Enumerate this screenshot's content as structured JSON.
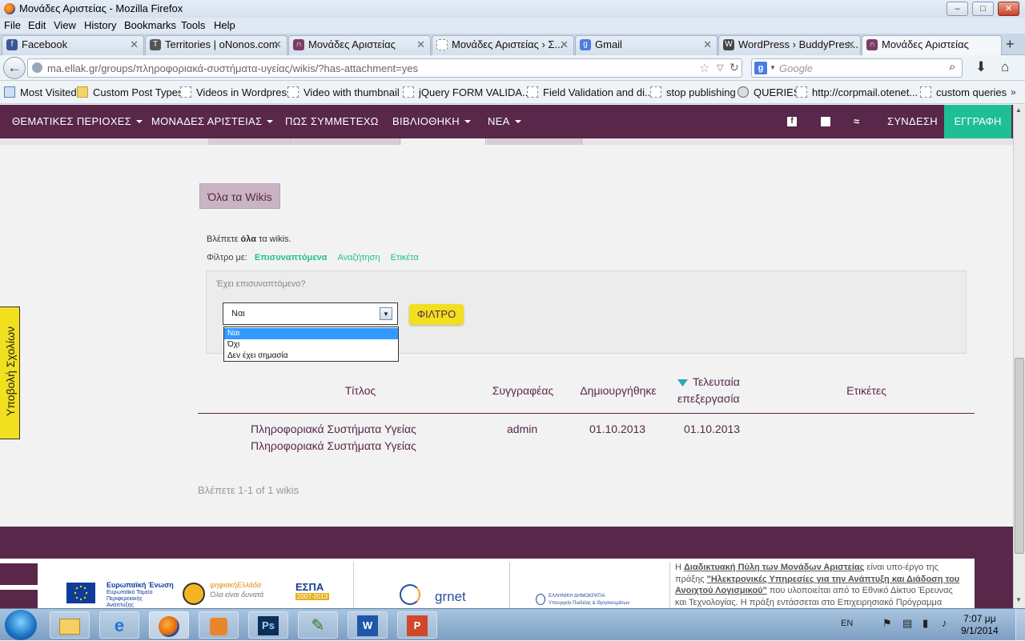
{
  "window": {
    "title": "Μονάδες Αριστείας - Mozilla Firefox",
    "min": "–",
    "max": "□",
    "close": "✕"
  },
  "menu": [
    "File",
    "Edit",
    "View",
    "History",
    "Bookmarks",
    "Tools",
    "Help"
  ],
  "tabs": [
    {
      "label": "Facebook",
      "icon": "f"
    },
    {
      "label": "Territories | oNonos.com",
      "icon": "T"
    },
    {
      "label": "Μονάδες Αριστείας",
      "icon": "∩"
    },
    {
      "label": "Μονάδες Αριστείας › Σ...",
      "icon": ""
    },
    {
      "label": "Gmail",
      "icon": "g"
    },
    {
      "label": "WordPress › BuddyPres...",
      "icon": "W"
    },
    {
      "label": "Μονάδες Αριστείας",
      "icon": "∩"
    }
  ],
  "new_tab": "+",
  "url": "ma.ellak.gr/groups/πληροφοριακά-συστήματα-υγείας/wikis/?has-attachment=yes",
  "search_placeholder": "Google",
  "bookmarks": [
    "Most Visited",
    "Custom Post Types",
    "Videos in Wordpress",
    "Video with thumbnail",
    "jQuery FORM VALIDA...",
    "Field Validation and di...",
    "stop publishing",
    "QUERIES",
    "http://corpmail.otenet...",
    "custom queries"
  ],
  "sitenav": {
    "items": [
      "ΘΕΜΑΤΙΚΕΣ ΠΕΡΙΟΧΕΣ",
      "ΜΟΝΑΔΕΣ ΑΡΙΣΤΕΙΑΣ",
      "ΠΩΣ ΣΥΜΜΕΤΕΧΩ",
      "ΒΙΒΛΙΟΘΗΚΗ",
      "ΝΕΑ"
    ],
    "login": "ΣΥΝΔΕΣΗ",
    "register": "ΕΓΓΡΑΦΗ"
  },
  "wikis": {
    "all_button": "Όλα τα Wikis",
    "viewing_pre": "Βλέπετε ",
    "viewing_bold": "όλα",
    "viewing_post": " τα wikis.",
    "filter_label": "Φίλτρο με:",
    "filters": [
      "Επισυναπτόμενα",
      "Αναζήτηση",
      "Ετικέτα"
    ],
    "question": "Έχει επισυναπτόμενο?",
    "selected": "Ναι",
    "options": [
      "Ναι",
      "Όχι",
      "Δεν έχει σημασία"
    ],
    "filter_button": "ΦΙΛΤΡΟ",
    "headers": {
      "title": "Τίτλος",
      "author": "Συγγραφέας",
      "created": "Δημιουργήθηκε",
      "edited_1": "Τελευταία",
      "edited_2": "επεξεργασία",
      "tags": "Ετικέτες"
    },
    "row": {
      "title_1": "Πληροφοριακά Συστήματα Υγείας",
      "title_2": "Πληροφοριακά Συστήματα Υγείας",
      "author": "admin",
      "created": "01.10.2013",
      "edited": "01.10.2013"
    },
    "paging": "Βλέπετε 1-1 of 1 wikis"
  },
  "footer": {
    "eu": "Ευρωπαϊκή Ένωση",
    "eu_sub": "Ευρωπαϊκό Ταμείο Περιφερειακής Ανάπτυξης",
    "digital": "ψηφιακήΕλλάδα",
    "digital_sub": "Όλα είναι δυνατά",
    "espa": "ΕΣΠΑ",
    "espa_sub": "2007-2013",
    "grnet": "grnet",
    "ministry": "ΕΛΛΗΝΙΚΗ ΔΗΜΟΚΡΑΤΙΑ",
    "ministry_sub": "Υπουργείο Παιδείας & Θρησκευμάτων",
    "text_1": "Η ",
    "link_1": "Διαδικτυακή Πύλη των Μονάδων Αριστείας",
    "text_2": " είναι υπο-έργο της πράξης ",
    "link_2": "\"Ηλεκτρονικές Υπηρεσίες για την Ανάπτυξη και Διάδοση του Ανοιχτού Λογισμικού\"",
    "text_3": " που υλοποιείται από το Εθνικό Δίκτυο Έρευνας και Τεχνολογίας. Η πράξη εντάσσεται στο Επιχειρησιακό Πρόγραμμα"
  },
  "feedback": "Υποβολή Σχολίων",
  "taskbar": {
    "lang": "EN",
    "time": "7:07 μμ",
    "date": "9/1/2014",
    "ps": "Ps",
    "word": "W",
    "ppt": "P"
  }
}
